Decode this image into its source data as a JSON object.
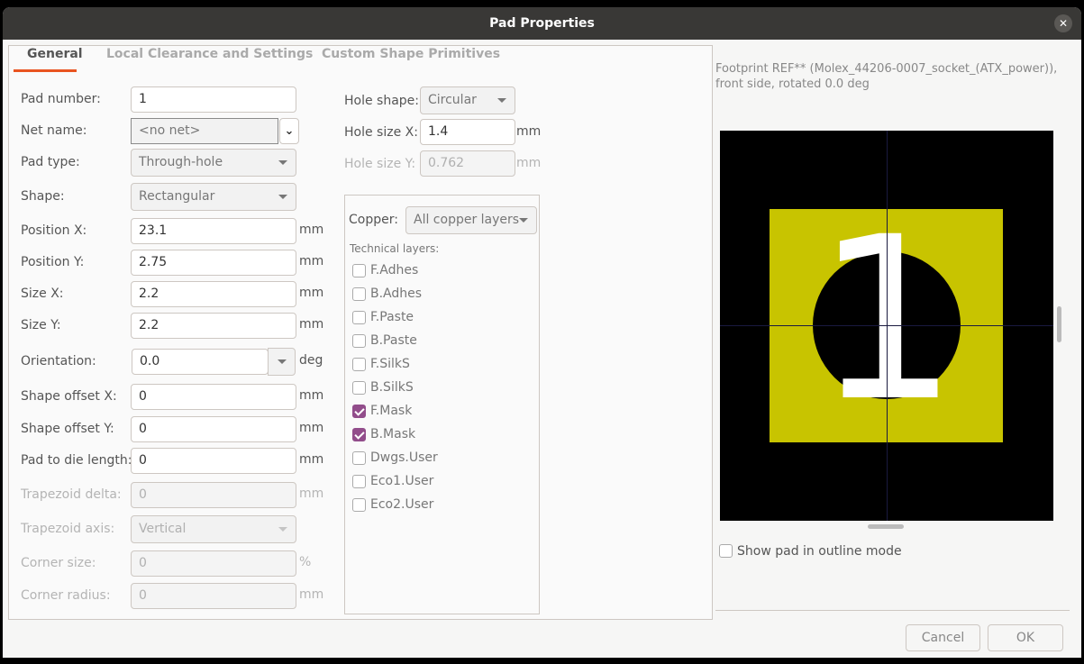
{
  "window": {
    "title": "Pad Properties"
  },
  "tabs": [
    "General",
    "Local Clearance and Settings",
    "Custom Shape Primitives"
  ],
  "fields": {
    "pad_number": {
      "label": "Pad number:",
      "value": "1"
    },
    "net_name": {
      "label": "Net name:",
      "value": "<no net>"
    },
    "pad_type": {
      "label": "Pad type:",
      "value": "Through-hole"
    },
    "shape": {
      "label": "Shape:",
      "value": "Rectangular"
    },
    "position_x": {
      "label": "Position X:",
      "value": "23.1",
      "unit": "mm"
    },
    "position_y": {
      "label": "Position Y:",
      "value": "2.75",
      "unit": "mm"
    },
    "size_x": {
      "label": "Size X:",
      "value": "2.2",
      "unit": "mm"
    },
    "size_y": {
      "label": "Size Y:",
      "value": "2.2",
      "unit": "mm"
    },
    "orientation": {
      "label": "Orientation:",
      "value": "0.0",
      "unit": "deg"
    },
    "shape_offset_x": {
      "label": "Shape offset X:",
      "value": "0",
      "unit": "mm"
    },
    "shape_offset_y": {
      "label": "Shape offset Y:",
      "value": "0",
      "unit": "mm"
    },
    "pad_to_die": {
      "label": "Pad to die length:",
      "value": "0",
      "unit": "mm"
    },
    "trapezoid_delta": {
      "label": "Trapezoid delta:",
      "value": "0",
      "unit": "mm"
    },
    "trapezoid_axis": {
      "label": "Trapezoid axis:",
      "value": "Vertical"
    },
    "corner_size": {
      "label": "Corner size:",
      "value": "0",
      "unit": "%"
    },
    "corner_radius": {
      "label": "Corner radius:",
      "value": "0",
      "unit": "mm"
    },
    "hole_shape": {
      "label": "Hole shape:",
      "value": "Circular"
    },
    "hole_size_x": {
      "label": "Hole size X:",
      "value": "1.4",
      "unit": "mm"
    },
    "hole_size_y": {
      "label": "Hole size Y:",
      "value": "0.762",
      "unit": "mm"
    }
  },
  "layers": {
    "copper_label": "Copper:",
    "copper_value": "All copper layers",
    "technical_label": "Technical layers:",
    "items": [
      {
        "name": "F.Adhes",
        "checked": false
      },
      {
        "name": "B.Adhes",
        "checked": false
      },
      {
        "name": "F.Paste",
        "checked": false
      },
      {
        "name": "B.Paste",
        "checked": false
      },
      {
        "name": "F.SilkS",
        "checked": false
      },
      {
        "name": "B.SilkS",
        "checked": false
      },
      {
        "name": "F.Mask",
        "checked": true
      },
      {
        "name": "B.Mask",
        "checked": true
      },
      {
        "name": "Dwgs.User",
        "checked": false
      },
      {
        "name": "Eco1.User",
        "checked": false
      },
      {
        "name": "Eco2.User",
        "checked": false
      }
    ]
  },
  "preview": {
    "info_line1": "Footprint REF** (Molex_44206-0007_socket_(ATX_power)),",
    "info_line2": "front side, rotated 0.0 deg",
    "pad_label": "1",
    "pad_color": "#c8c400",
    "outline_label": "Show pad in outline mode"
  },
  "buttons": {
    "cancel": "Cancel",
    "ok": "OK"
  }
}
